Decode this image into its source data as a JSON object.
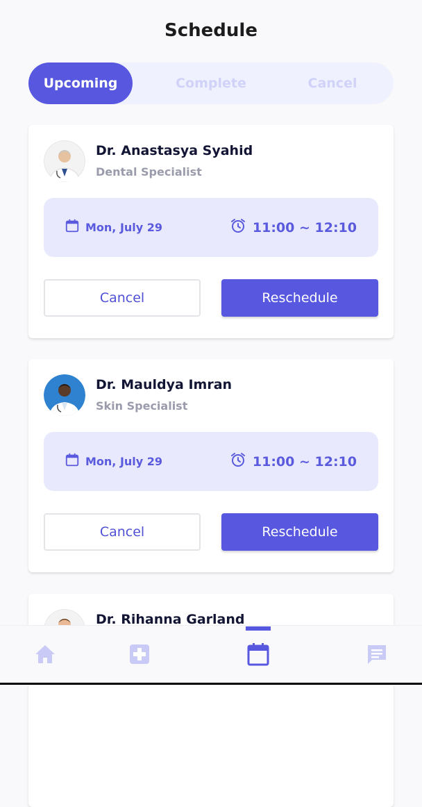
{
  "header": {
    "title": "Schedule"
  },
  "segments": [
    {
      "label": "Upcoming",
      "active": true
    },
    {
      "label": "Complete",
      "active": false
    },
    {
      "label": "Cancel",
      "active": false
    }
  ],
  "appointments": [
    {
      "doctor": "Dr. Anastasya Syahid",
      "specialty": "Dental Specialist",
      "date": "Mon, July 29",
      "time": "11:00 ~ 12:10",
      "cancel_label": "Cancel",
      "reschedule_label": "Reschedule",
      "avatar_icon": "doctor-avatar-gray-hair"
    },
    {
      "doctor": "Dr. Mauldya Imran",
      "specialty": "Skin Specialist",
      "date": "Mon, July 29",
      "time": "11:00 ~ 12:10",
      "cancel_label": "Cancel",
      "reschedule_label": "Reschedule",
      "avatar_icon": "doctor-avatar-blue-bg"
    },
    {
      "doctor": "Dr. Rihanna Garland",
      "avatar_icon": "doctor-avatar-partial"
    }
  ],
  "tabbar": {
    "items": [
      {
        "icon": "home-icon",
        "active": false
      },
      {
        "icon": "medical-cross-icon",
        "active": false
      },
      {
        "icon": "calendar-icon",
        "active": true
      },
      {
        "icon": "chat-icon",
        "active": false
      }
    ]
  },
  "colors": {
    "accent": "#5757e0",
    "accent_light": "#e8e9fd",
    "segment_bg": "#f0f1fe",
    "inactive_icon": "#c9cbf6",
    "text_dark": "#131534",
    "text_muted": "#9a9bab"
  }
}
